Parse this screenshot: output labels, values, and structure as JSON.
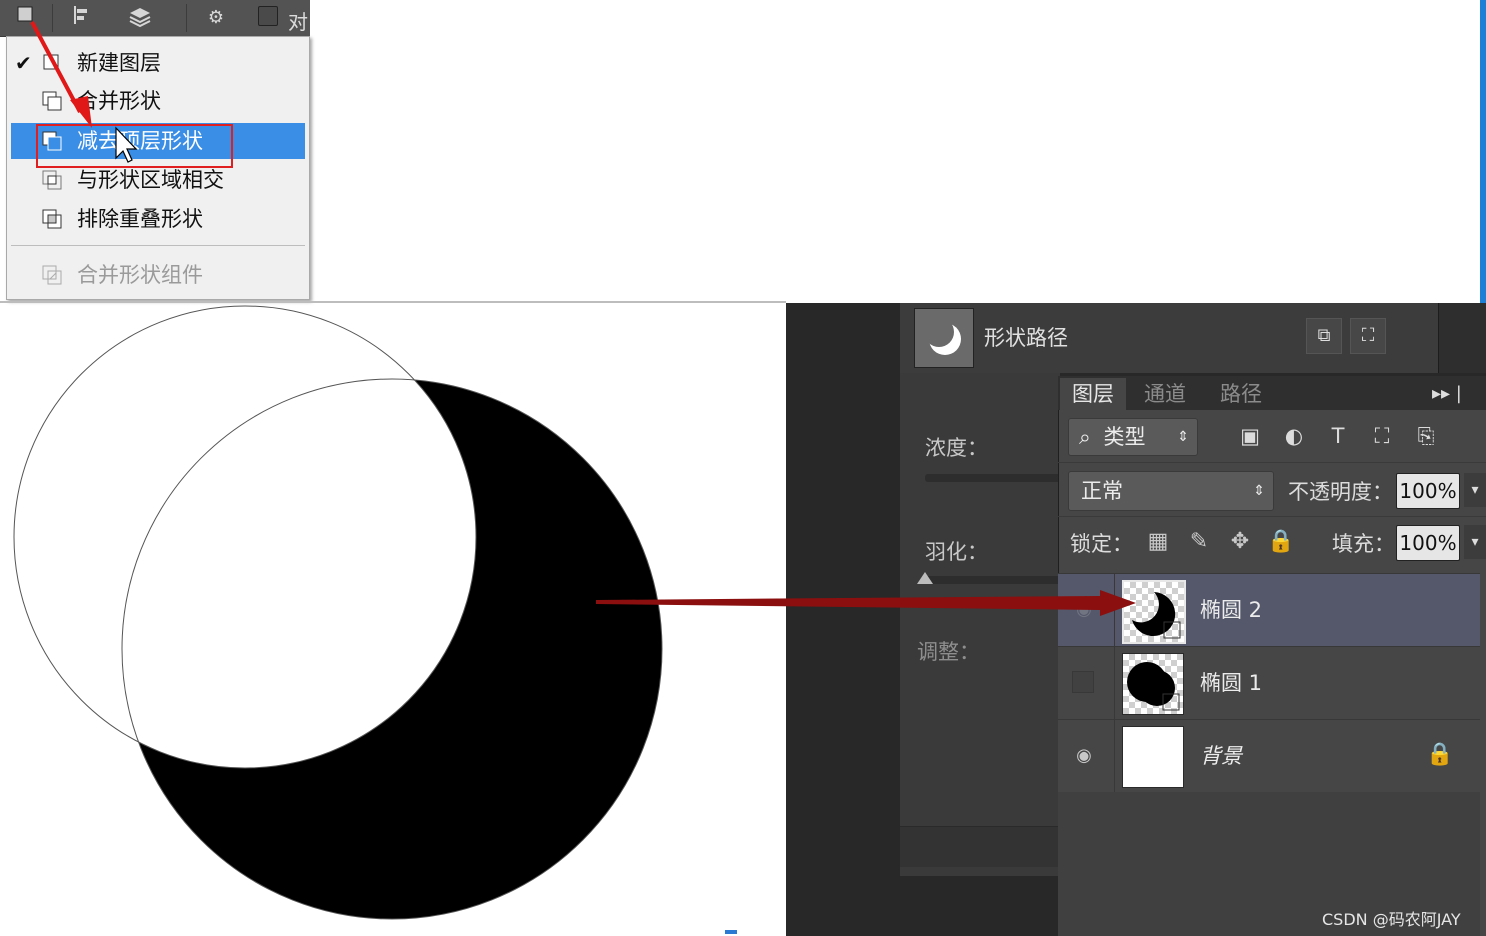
{
  "toolbar": {
    "icons": [
      "new-layer-mode-icon",
      "align-icon",
      "arrange-icon",
      "settings-icon"
    ],
    "checkbox_label": "对"
  },
  "menu": {
    "items": [
      {
        "label": "新建图层",
        "checked": true,
        "selected": false,
        "disabled": false
      },
      {
        "label": "合并形状",
        "checked": false,
        "selected": false,
        "disabled": false
      },
      {
        "label": "减去顶层形状",
        "checked": false,
        "selected": true,
        "disabled": false
      },
      {
        "label": "与形状区域相交",
        "checked": false,
        "selected": false,
        "disabled": false
      },
      {
        "label": "排除重叠形状",
        "checked": false,
        "selected": false,
        "disabled": false
      },
      {
        "label": "合并形状组件",
        "checked": false,
        "selected": false,
        "disabled": true
      }
    ],
    "check_mark": "✔"
  },
  "properties": {
    "title": "形状路径",
    "density_label": "浓度：",
    "feather_label": "羽化：",
    "adjust_label": "调整："
  },
  "layers_panel": {
    "tabs": [
      "图层",
      "通道",
      "路径"
    ],
    "active_tab": "图层",
    "more": "▸▸ |",
    "filter_kind": "类型",
    "blend_mode": "正常",
    "opacity_label": "不透明度：",
    "opacity_value": "100%",
    "lock_label": "锁定：",
    "fill_label": "填充：",
    "fill_value": "100%",
    "layers": [
      {
        "name": "椭圆 2",
        "visible": true,
        "selected": true
      },
      {
        "name": "椭圆 1",
        "visible": false,
        "selected": false
      },
      {
        "name": "背景",
        "visible": true,
        "selected": false,
        "locked": true
      }
    ]
  },
  "watermark": "CSDN @码农阿JAY",
  "colors": {
    "menu_selected": "#3a8ee6",
    "highlight_box": "#e02020",
    "arrow_red": "#e01818",
    "arrow_dark_red": "#8b0f0f",
    "layer_selected": "#54586a"
  }
}
